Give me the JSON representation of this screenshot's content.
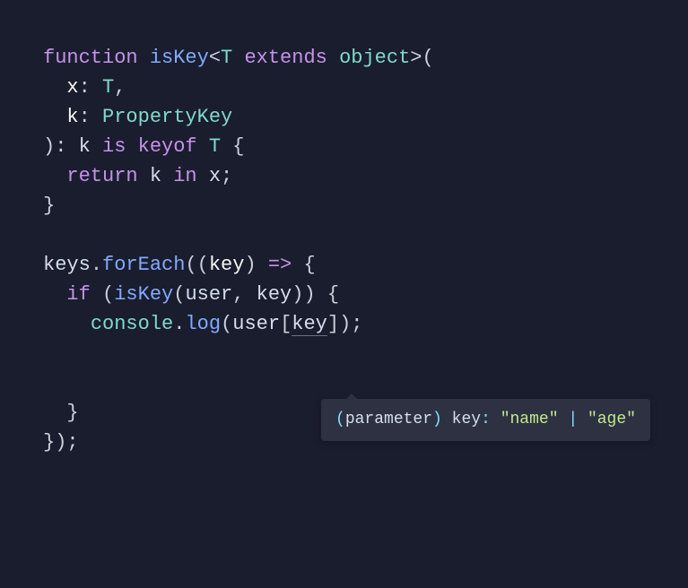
{
  "code": {
    "kw_function": "function",
    "fn_isKey": "isKey",
    "generic_T": "T",
    "kw_extends": "extends",
    "type_object": "object",
    "param_x": "x",
    "type_T": "T",
    "param_k": "k",
    "type_PropertyKey": "PropertyKey",
    "pred_k": "k",
    "kw_is": "is",
    "kw_keyof": "keyof",
    "pred_T": "T",
    "kw_return": "return",
    "ret_k": "k",
    "kw_in": "in",
    "ret_x": "x",
    "var_keys": "keys",
    "method_forEach": "forEach",
    "param_key": "key",
    "kw_if": "if",
    "call_isKey": "isKey",
    "arg_user": "user",
    "arg_key": "key",
    "obj_console": "console",
    "method_log": "log",
    "idx_user": "user",
    "idx_key": "key"
  },
  "tooltip": {
    "label_parameter": "parameter",
    "ident": "key",
    "type_lit1": "\"name\"",
    "type_lit2": "\"age\""
  }
}
